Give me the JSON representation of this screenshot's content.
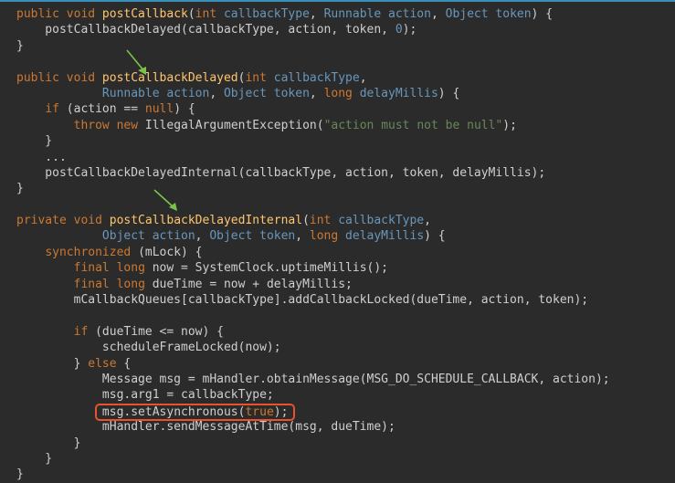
{
  "code_lines": [
    [
      [
        "kw",
        "public void "
      ],
      [
        "fn",
        "postCallback"
      ],
      [
        "tx",
        "("
      ],
      [
        "kw",
        "int "
      ],
      [
        "ty",
        "callbackType"
      ],
      [
        "tx",
        ", "
      ],
      [
        "ty",
        "Runnable action"
      ],
      [
        "tx",
        ", "
      ],
      [
        "ty",
        "Object token"
      ],
      [
        "tx",
        ") {"
      ]
    ],
    [
      [
        "tx",
        "    postCallbackDelayed(callbackType, action, token, "
      ],
      [
        "num",
        "0"
      ],
      [
        "tx",
        ");"
      ]
    ],
    [
      [
        "tx",
        "}"
      ]
    ],
    [],
    [
      [
        "kw",
        "public void "
      ],
      [
        "fn",
        "postCallbackDelayed"
      ],
      [
        "tx",
        "("
      ],
      [
        "kw",
        "int "
      ],
      [
        "ty",
        "callbackType"
      ],
      [
        "tx",
        ","
      ]
    ],
    [
      [
        "tx",
        "            "
      ],
      [
        "ty",
        "Runnable action"
      ],
      [
        "tx",
        ", "
      ],
      [
        "ty",
        "Object token"
      ],
      [
        "tx",
        ", "
      ],
      [
        "kw",
        "long "
      ],
      [
        "ty",
        "delayMillis"
      ],
      [
        "tx",
        ") {"
      ]
    ],
    [
      [
        "tx",
        "    "
      ],
      [
        "kw",
        "if "
      ],
      [
        "tx",
        "(action == "
      ],
      [
        "kw",
        "null"
      ],
      [
        "tx",
        ") {"
      ]
    ],
    [
      [
        "tx",
        "        "
      ],
      [
        "kw",
        "throw new "
      ],
      [
        "tx",
        "IllegalArgumentException("
      ],
      [
        "str",
        "\"action must not be null\""
      ],
      [
        "tx",
        ");"
      ]
    ],
    [
      [
        "tx",
        "    }"
      ]
    ],
    [
      [
        "tx",
        "    ..."
      ]
    ],
    [
      [
        "tx",
        "    postCallbackDelayedInternal(callbackType, action, token, delayMillis);"
      ]
    ],
    [
      [
        "tx",
        "}"
      ]
    ],
    [],
    [
      [
        "kw",
        "private void "
      ],
      [
        "fn",
        "postCallbackDelayedInternal"
      ],
      [
        "tx",
        "("
      ],
      [
        "kw",
        "int "
      ],
      [
        "ty",
        "callbackType"
      ],
      [
        "tx",
        ","
      ]
    ],
    [
      [
        "tx",
        "            "
      ],
      [
        "ty",
        "Object action"
      ],
      [
        "tx",
        ", "
      ],
      [
        "ty",
        "Object token"
      ],
      [
        "tx",
        ", "
      ],
      [
        "kw",
        "long "
      ],
      [
        "ty",
        "delayMillis"
      ],
      [
        "tx",
        ") {"
      ]
    ],
    [
      [
        "tx",
        "    "
      ],
      [
        "kw",
        "synchronized "
      ],
      [
        "tx",
        "(mLock) {"
      ]
    ],
    [
      [
        "tx",
        "        "
      ],
      [
        "kw",
        "final long "
      ],
      [
        "tx",
        "now = SystemClock.uptimeMillis();"
      ]
    ],
    [
      [
        "tx",
        "        "
      ],
      [
        "kw",
        "final long "
      ],
      [
        "tx",
        "dueTime = now + delayMillis;"
      ]
    ],
    [
      [
        "tx",
        "        mCallbackQueues[callbackType].addCallbackLocked(dueTime, action, token);"
      ]
    ],
    [],
    [
      [
        "tx",
        "        "
      ],
      [
        "kw",
        "if "
      ],
      [
        "tx",
        "(dueTime <= now) {"
      ]
    ],
    [
      [
        "tx",
        "            scheduleFrameLocked(now);"
      ]
    ],
    [
      [
        "tx",
        "        } "
      ],
      [
        "kw",
        "else "
      ],
      [
        "tx",
        "{"
      ]
    ],
    [
      [
        "tx",
        "            Message msg = mHandler.obtainMessage(MSG_DO_SCHEDULE_CALLBACK, action);"
      ]
    ],
    [
      [
        "tx",
        "            msg.arg1 = callbackType;"
      ]
    ],
    [
      [
        "tx",
        "            "
      ],
      [
        "hl",
        "msg.setAsynchronous("
      ],
      [
        "hlkw",
        "true"
      ],
      [
        "hlend",
        ");"
      ]
    ],
    [
      [
        "tx",
        "            mHandler.sendMessageAtTime(msg, dueTime);"
      ]
    ],
    [
      [
        "tx",
        "        }"
      ]
    ],
    [
      [
        "tx",
        "    }"
      ]
    ],
    [
      [
        "tx",
        "}"
      ]
    ]
  ],
  "colors": {
    "background": "#2b2b2b",
    "keyword": "#cc7832",
    "method_name": "#ffc66d",
    "param": "#6897bb",
    "text": "#cfcfcf",
    "string": "#6a8759",
    "highlight_box": "#e8532d",
    "arrow": "#7cc24a"
  }
}
